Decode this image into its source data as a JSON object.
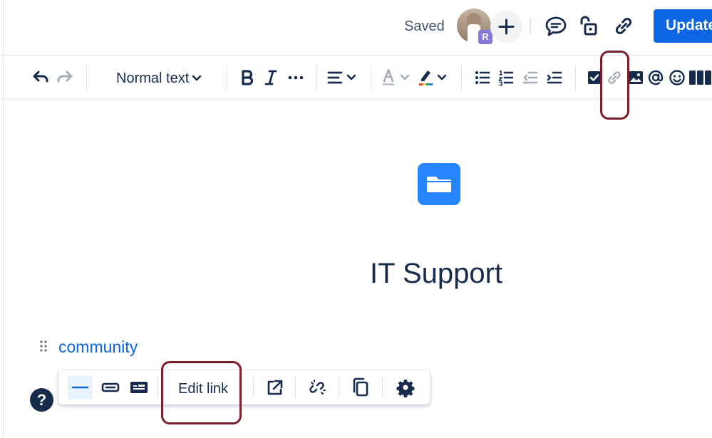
{
  "topbar": {
    "saved_label": "Saved",
    "avatar_badge": "R",
    "update_label": "Update"
  },
  "toolbar": {
    "text_style": "Normal text",
    "items": [
      "undo-icon",
      "redo-icon",
      "bold-icon",
      "italic-icon",
      "more-formatting-icon",
      "align-icon",
      "text-color-icon",
      "highlight-icon",
      "bullet-list-icon",
      "numbered-list-icon",
      "outdent-icon",
      "indent-icon",
      "task-icon",
      "link-icon",
      "image-icon",
      "mention-icon",
      "emoji-icon",
      "layout-icon"
    ]
  },
  "content": {
    "title": "IT Support",
    "link_text": "community"
  },
  "link_toolbar": {
    "edit_link_label": "Edit link"
  },
  "help": {
    "label": "?"
  },
  "colors": {
    "accent": "#0c66e4",
    "highlight_box": "#7a1d2b",
    "page_icon": "#2684ff"
  }
}
